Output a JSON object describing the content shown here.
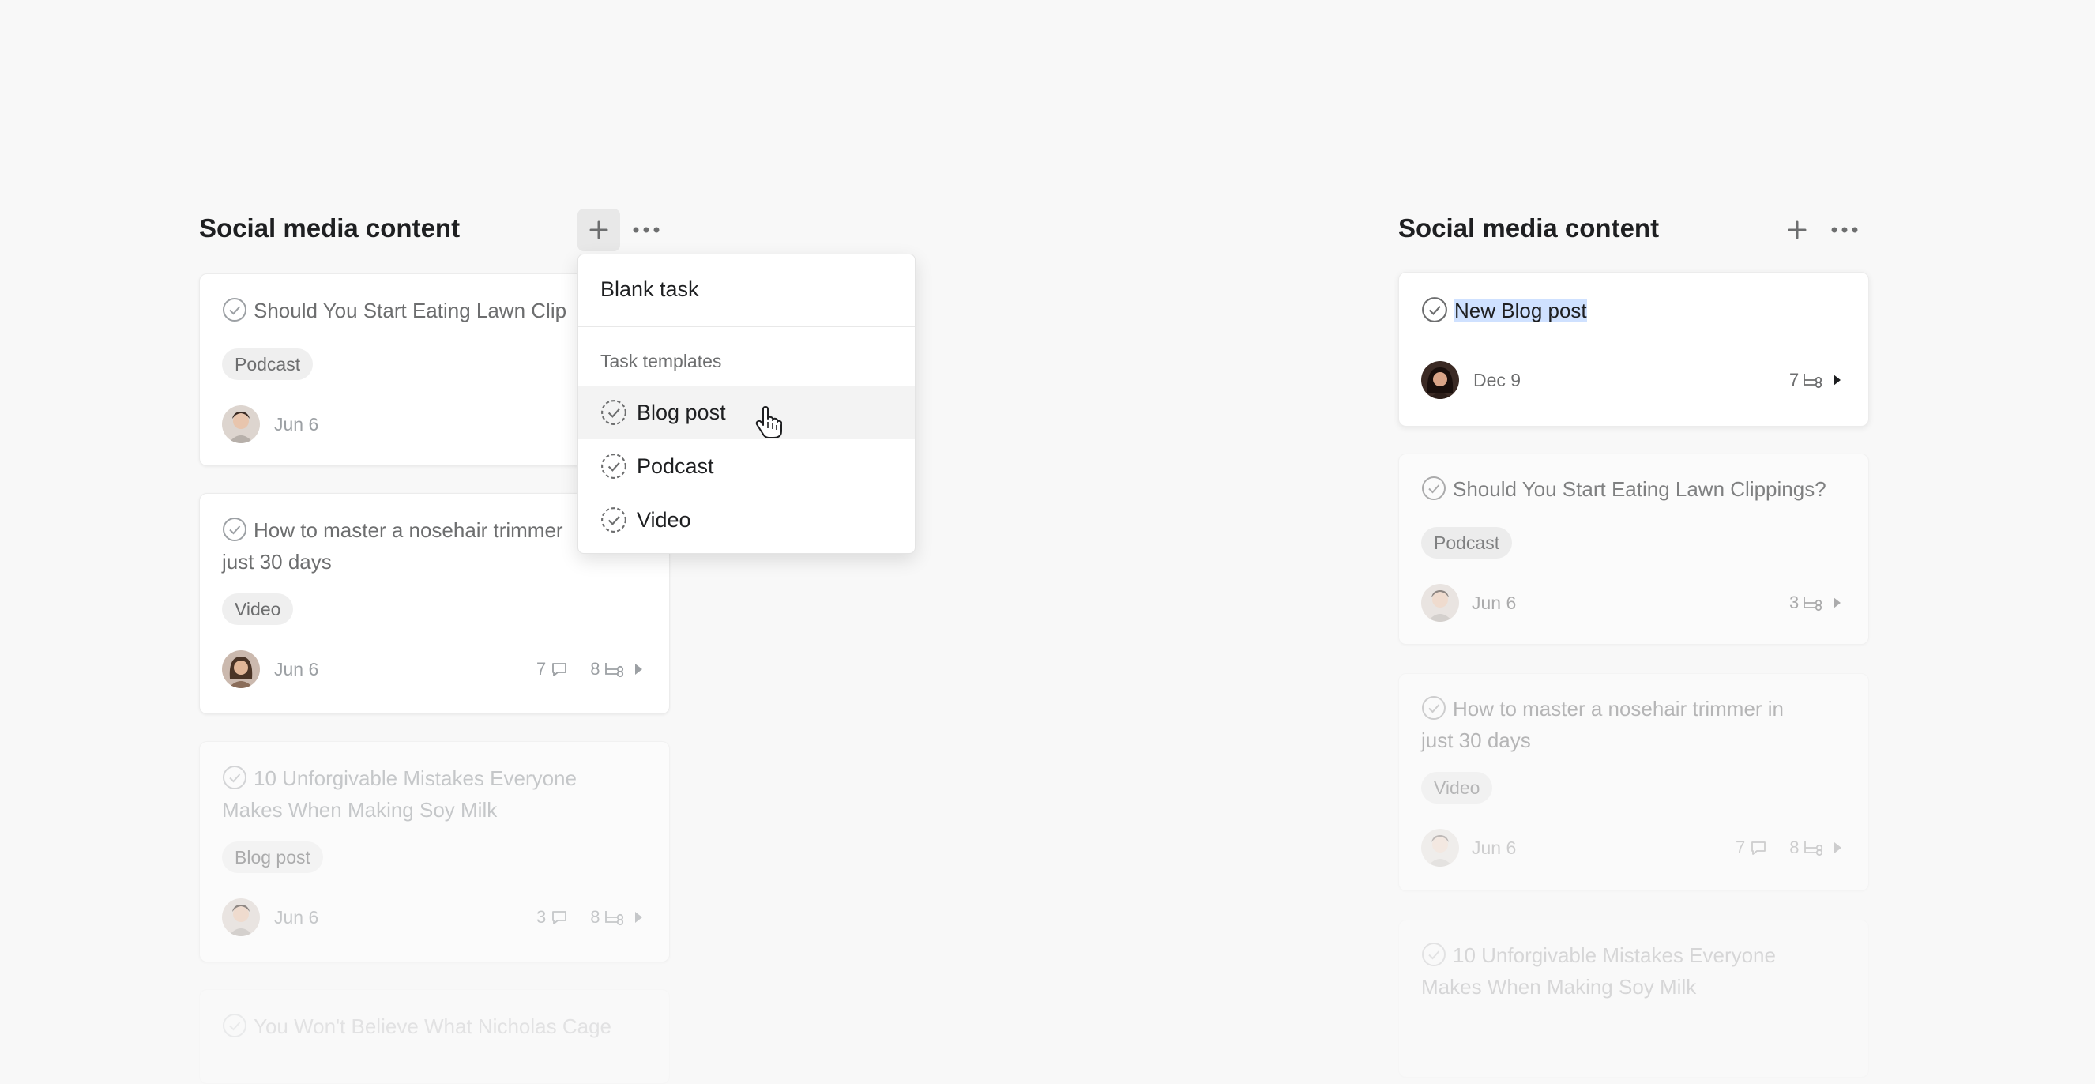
{
  "left_column": {
    "title": "Social media content",
    "cards": [
      {
        "title": "Should You Start Eating Lawn Clip",
        "tag": "Podcast",
        "date": "Jun 6"
      },
      {
        "title_line1": "How to master a nosehair trimmer",
        "title_line2": "just 30 days",
        "tag": "Video",
        "date": "Jun 6",
        "comments": "7",
        "subtasks": "8"
      },
      {
        "title_line1": "10 Unforgivable Mistakes Everyone",
        "title_line2": "Makes When Making Soy Milk",
        "tag": "Blog post",
        "date": "Jun 6",
        "comments": "3",
        "subtasks": "8"
      },
      {
        "title": "You Won't Believe What Nicholas Cage"
      }
    ]
  },
  "menu": {
    "blank_task": "Blank task",
    "section_label": "Task templates",
    "templates": [
      "Blog post",
      "Podcast",
      "Video"
    ]
  },
  "right_column": {
    "title": "Social media content",
    "cards": [
      {
        "title": "New Blog post",
        "date": "Dec 9",
        "subtasks": "7"
      },
      {
        "title": "Should You Start Eating Lawn Clippings?",
        "tag": "Podcast",
        "date": "Jun 6",
        "subtasks": "3"
      },
      {
        "title_line1": "How to master a nosehair trimmer in",
        "title_line2": "just 30 days",
        "tag": "Video",
        "date": "Jun 6",
        "comments": "7",
        "subtasks": "8"
      },
      {
        "title_line1": "10 Unforgivable Mistakes Everyone",
        "title_line2": "Makes When Making Soy Milk"
      }
    ]
  },
  "icons": {
    "add": "plus-icon",
    "more": "more-horizontal-icon",
    "check": "check-circle-icon",
    "template": "dashed-check-circle-icon",
    "comment": "comment-icon",
    "subtask": "subtask-icon",
    "expand": "triangle-right-icon",
    "cursor": "hand-pointer-icon"
  }
}
